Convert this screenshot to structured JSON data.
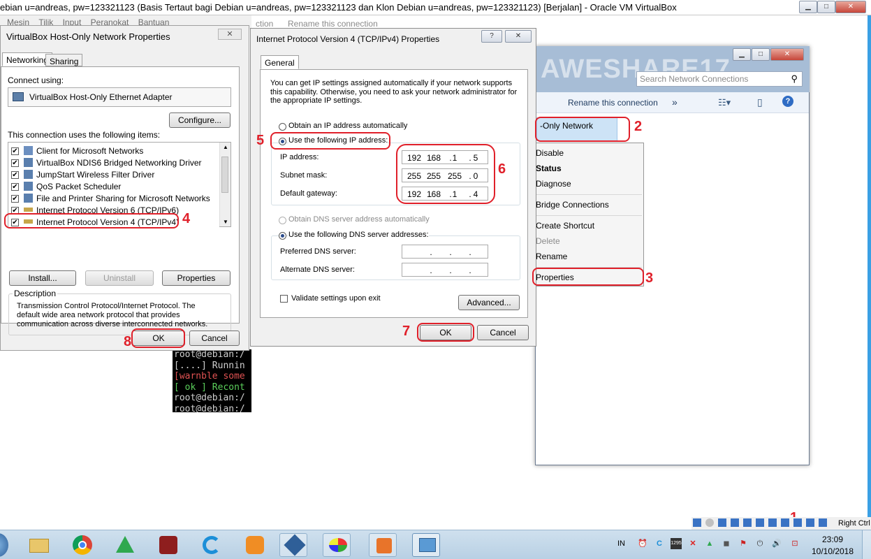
{
  "vbox": {
    "title": "ebian u=andreas, pw=123321123 (Basis Tertaut bagi Debian u=andreas, pw=123321123 dan Klon Debian u=andreas, pw=123321123) [Berjalan] - Oracle VM VirtualBox",
    "menu": [
      "Mesin",
      "Tilik",
      "Input",
      "Peranokat",
      "Bantuan"
    ],
    "menu_behind": "ction",
    "status_right_label": "Right Ctrl"
  },
  "hostonly": {
    "title": "VirtualBox Host-Only Network Properties",
    "tabs": [
      "Networking",
      "Sharing"
    ],
    "connect_using_label": "Connect using:",
    "adapter_name": "VirtualBox Host-Only Ethernet Adapter",
    "configure_label": "Configure...",
    "items_label": "This connection uses the following items:",
    "items": [
      {
        "label": "Client for Microsoft Networks",
        "checked": true
      },
      {
        "label": "VirtualBox NDIS6 Bridged Networking Driver",
        "checked": true
      },
      {
        "label": "JumpStart Wireless Filter Driver",
        "checked": true
      },
      {
        "label": "QoS Packet Scheduler",
        "checked": true
      },
      {
        "label": "File and Printer Sharing for Microsoft Networks",
        "checked": true
      },
      {
        "label": "Internet Protocol Version 6 (TCP/IPv6)",
        "checked": true
      },
      {
        "label": "Internet Protocol Version 4 (TCP/IPv4)",
        "checked": true
      }
    ],
    "install_label": "Install...",
    "uninstall_label": "Uninstall",
    "properties_label": "Properties",
    "description_label": "Description",
    "description_text": "Transmission Control Protocol/Internet Protocol. The default wide area network protocol that provides communication across diverse interconnected networks.",
    "ok_label": "OK",
    "cancel_label": "Cancel"
  },
  "ipv4": {
    "title": "Internet Protocol Version 4 (TCP/IPv4) Properties",
    "help_label": "?",
    "tab": "General",
    "intro": "You can get IP settings assigned automatically if your network supports this capability. Otherwise, you need to ask your network administrator for the appropriate IP settings.",
    "auto_ip_label": "Obtain an IP address automatically",
    "manual_ip_label": "Use the following IP address:",
    "ip_label": "IP address:",
    "ip_value": [
      "192",
      "168",
      "1",
      "5"
    ],
    "mask_label": "Subnet mask:",
    "mask_value": [
      "255",
      "255",
      "255",
      "0"
    ],
    "gateway_label": "Default gateway:",
    "gateway_value": [
      "192",
      "168",
      "1",
      "4"
    ],
    "auto_dns_label": "Obtain DNS server address automatically",
    "manual_dns_label": "Use the following DNS server addresses:",
    "preferred_dns_label": "Preferred DNS server:",
    "alternate_dns_label": "Alternate DNS server:",
    "validate_label": "Validate settings upon exit",
    "advanced_label": "Advanced...",
    "ok_label": "OK",
    "cancel_label": "Cancel"
  },
  "netconn": {
    "search_placeholder": "Search Network Connections",
    "watermark": "AWESHARE17",
    "toolbar_rename": "Rename this connection",
    "toolbar_more": "»",
    "behind_toolbar": "Rename this connection",
    "adapter_label": "-Only Network",
    "context_menu": [
      "Disable",
      "Status",
      "Diagnose",
      "Bridge Connections",
      "Create Shortcut",
      "Delete",
      "Rename",
      "Properties"
    ]
  },
  "terminal": {
    "lines": [
      "root@debian:/",
      "[....] Runnin",
      "[warnble some",
      "[ ok ] Recont",
      "root@debian:/",
      "root@debian:/"
    ]
  },
  "annotations": [
    "1",
    "2",
    "3",
    "4",
    "5",
    "6",
    "7",
    "8"
  ],
  "taskbar": {
    "language": "IN",
    "time": "23:09",
    "date": "10/10/2018",
    "apps": [
      "file-explorer",
      "chrome",
      "app-green",
      "app-red",
      "ccleaner",
      "uc-browser",
      "virtualbox",
      "paint",
      "media-player",
      "network-app"
    ]
  },
  "colors": {
    "annotation": "#e0202a",
    "taskbar": "#c3d8ea",
    "accent": "#2a4a8a"
  }
}
